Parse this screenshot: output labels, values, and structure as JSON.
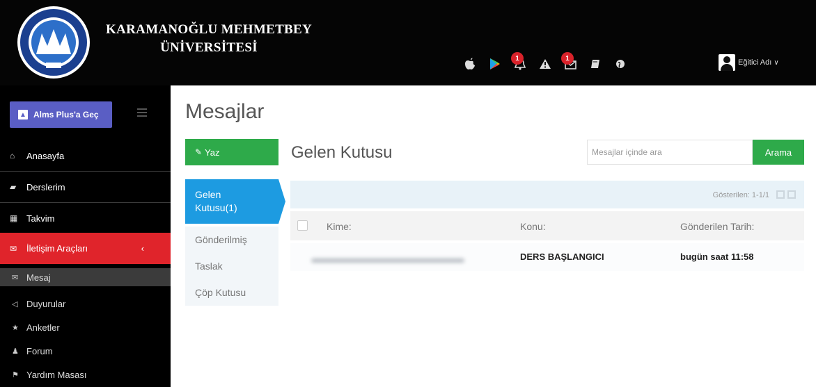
{
  "header": {
    "university_line1": "KARAMANOĞLU MEHMETBEY",
    "university_line2": "ÜNİVERSİTESİ",
    "icons": [
      {
        "name": "apple-icon",
        "glyph": ""
      },
      {
        "name": "google-play-icon",
        "glyph": "▶"
      },
      {
        "name": "notification-bell-icon",
        "glyph": "🔔",
        "badge": "1"
      },
      {
        "name": "warning-icon",
        "glyph": "▲"
      },
      {
        "name": "messages-icon",
        "glyph": "✉",
        "badge": "1"
      },
      {
        "name": "book-icon",
        "glyph": "▰"
      },
      {
        "name": "globe-icon",
        "glyph": "●"
      }
    ],
    "user_name": "Eğitici Adı",
    "user_caret": "∨"
  },
  "sidebar": {
    "plus_button": "Alms Plus'a Geç",
    "items": [
      {
        "label": "Anasayfa",
        "icon": "home-icon",
        "glyph": "⌂"
      },
      {
        "label": "Derslerim",
        "icon": "book-icon",
        "glyph": "▰"
      },
      {
        "label": "Takvim",
        "icon": "calendar-icon",
        "glyph": "▦"
      },
      {
        "label": "İletişim Araçları",
        "icon": "envelope-icon",
        "glyph": "✉",
        "arrow": "‹"
      }
    ],
    "subitems": [
      {
        "label": "Mesaj",
        "icon": "envelope-icon",
        "glyph": "✉"
      },
      {
        "label": "Duyurular",
        "icon": "megaphone-icon",
        "glyph": "◁"
      },
      {
        "label": "Anketler",
        "icon": "star-icon",
        "glyph": "★"
      },
      {
        "label": "Forum",
        "icon": "users-icon",
        "glyph": "♟"
      },
      {
        "label": "Yardım Masası",
        "icon": "flag-icon",
        "glyph": "⚑"
      }
    ]
  },
  "main": {
    "page_title": "Mesajlar",
    "compose_button": "Yaz",
    "compose_glyph": "✎",
    "folders": [
      "Gelen Kutusu(1)",
      "Gönderilmiş",
      "Taslak",
      "Çöp Kutusu"
    ],
    "box_title": "Gelen Kutusu",
    "search_placeholder": "Mesajlar içinde ara",
    "search_button": "Arama",
    "showing_text": "Gösterilen: 1-1/1",
    "columns": {
      "to": "Kime:",
      "subject": "Konu:",
      "date": "Gönderilen Tarih:"
    },
    "rows": [
      {
        "subject": "DERS BAŞLANGICI",
        "date": "bugün saat 11:58"
      }
    ]
  },
  "colors": {
    "header_bg": "#050505",
    "accent_green": "#2eaa4a",
    "active_blue": "#1d9be1",
    "active_red": "#e0242b",
    "plus_purple": "#5a5ec4"
  }
}
